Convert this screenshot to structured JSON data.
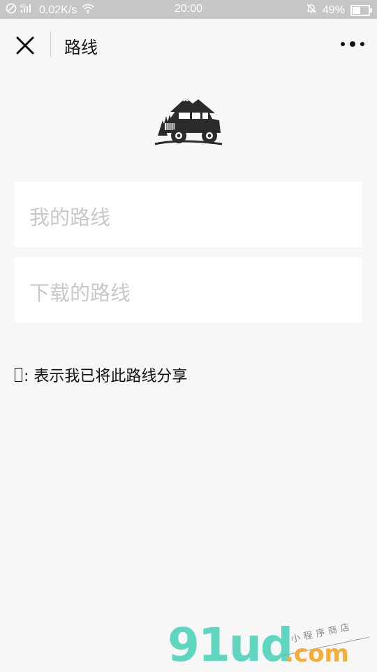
{
  "status_bar": {
    "network_speed": "0.02K/s",
    "signal_label": "4G",
    "time": "20:00",
    "battery_percent": "49%",
    "battery_level": 0.49
  },
  "nav": {
    "title": "路线",
    "close_icon": "close-icon",
    "more_icon": "more-dots-icon"
  },
  "logo_icon": "jeep-mountain-logo",
  "menu": {
    "my_routes": "我的路线",
    "downloaded_routes": "下载的路线"
  },
  "note": {
    "text": ": 表示我已将此路线分享"
  },
  "watermark": {
    "brand": "91ud",
    "domain": ".com",
    "tagline": "小程序商店"
  },
  "colors": {
    "background": "#f7f7f7",
    "status_bar": "#c6c6c6",
    "card": "#ffffff",
    "placeholder_text": "#c8c8c8",
    "watermark_green": "#5fd6c0",
    "watermark_orange": "#f7ad33"
  }
}
